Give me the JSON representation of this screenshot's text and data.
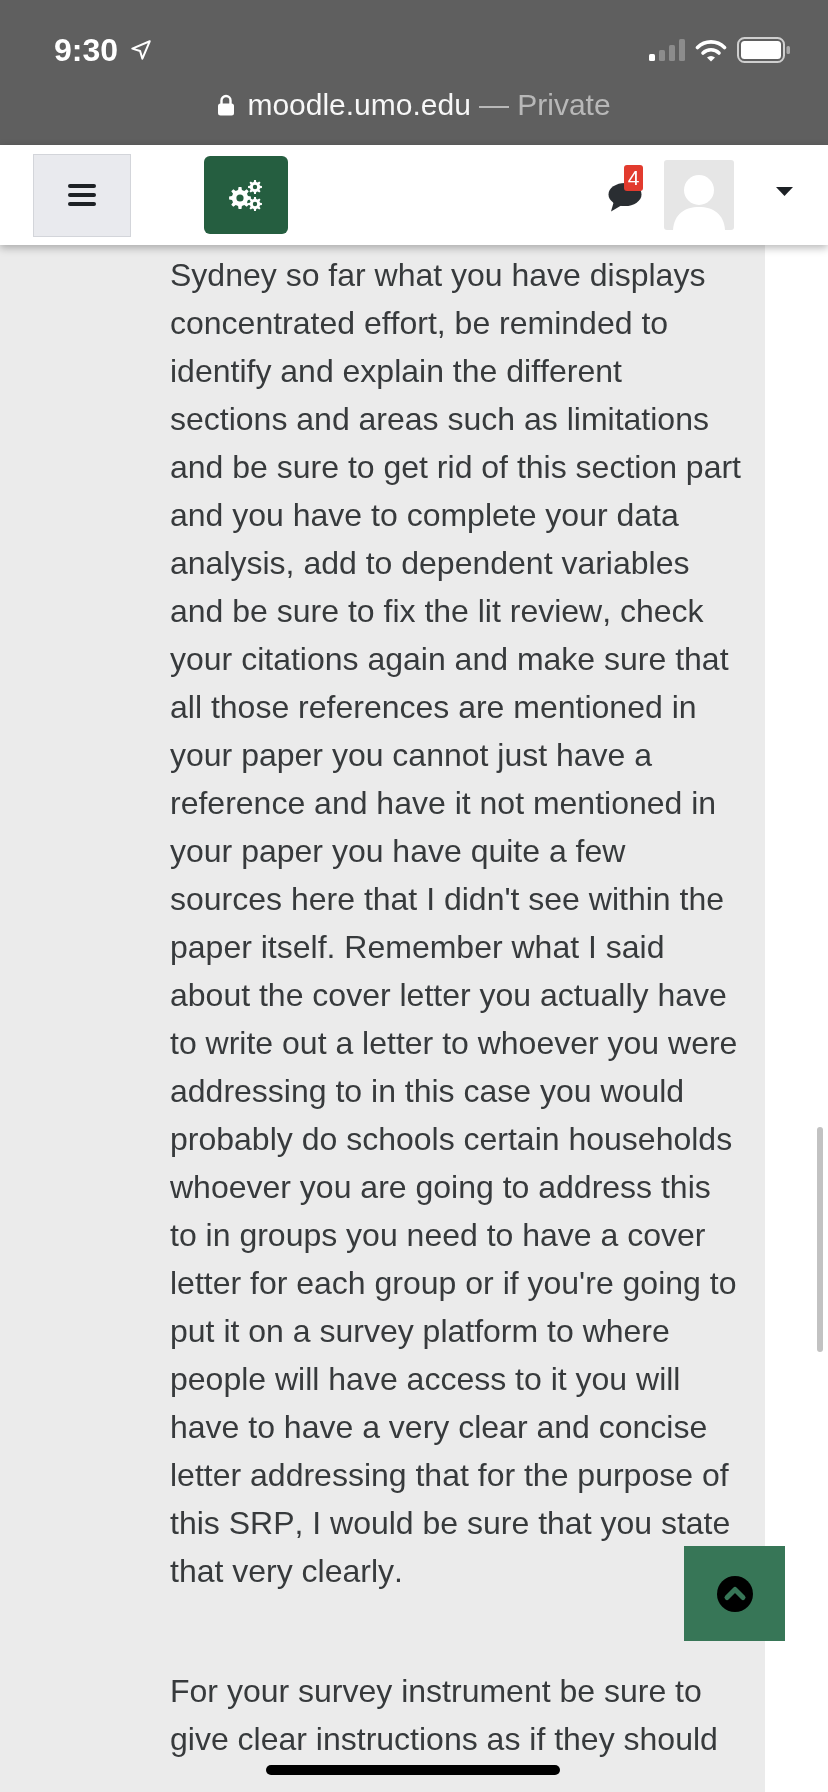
{
  "status_bar": {
    "time": "9:30"
  },
  "address_bar": {
    "domain": "moodle.umo.edu",
    "mode": "— Private"
  },
  "navbar": {
    "notification_count": "4"
  },
  "post": {
    "paragraphs": [
      "Sydney so far what you have displays concentrated effort, be reminded to identify and explain the different sections and areas such as limitations and be sure to get rid of this section part and you have to complete your data analysis, add to dependent variables and be sure to fix the lit review, check your citations again and make sure that all those references are mentioned in your paper you cannot just have a reference and have it not mentioned in your paper you have quite a few sources here that I didn't see within the paper itself. Remember what I said about the cover letter you actually have to write out a letter to whoever you were addressing to in this case you would probably do schools certain households whoever you are going to address this to in groups you need to have a cover letter for each group or if you're going to put it on a survey platform to where people will have access to it you will have to have a very clear and concise letter addressing that for the purpose of this SRP, I would be sure that you state that very clearly.",
      "For your survey instrument be sure to give clear instructions as if they should"
    ]
  }
}
